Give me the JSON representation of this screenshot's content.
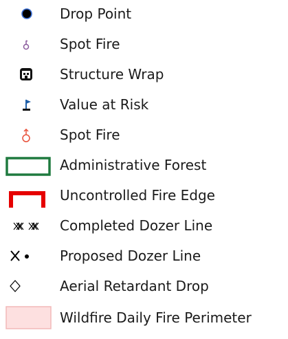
{
  "legend": {
    "items": [
      {
        "label": "Drop Point",
        "icon": "drop-point-icon",
        "color": "#000000"
      },
      {
        "label": "Spot Fire",
        "icon": "spot-fire-small-icon",
        "color": "#8a5a9c"
      },
      {
        "label": "Structure Wrap",
        "icon": "structure-wrap-icon",
        "color": "#111111"
      },
      {
        "label": "Value at Risk",
        "icon": "value-at-risk-flag-icon",
        "color": "#1f5fa8"
      },
      {
        "label": "Spot Fire",
        "icon": "spot-fire-icon",
        "color": "#e8503a"
      },
      {
        "label": "Administrative Forest",
        "icon": "administrative-forest-box-icon",
        "color": "#1f7a3f"
      },
      {
        "label": "Uncontrolled Fire Edge",
        "icon": "uncontrolled-fire-edge-icon",
        "color": "#e60000"
      },
      {
        "label": "Completed Dozer Line",
        "icon": "completed-dozer-line-icon",
        "color": "#000000"
      },
      {
        "label": "Proposed Dozer Line",
        "icon": "proposed-dozer-line-icon",
        "color": "#000000"
      },
      {
        "label": "Aerial Retardant Drop",
        "icon": "aerial-retardant-drop-icon",
        "color": "#000000"
      },
      {
        "label": "Wildfire Daily Fire Perimeter",
        "icon": "wildfire-perimeter-swatch-icon",
        "color": "#fde0e0"
      }
    ]
  }
}
